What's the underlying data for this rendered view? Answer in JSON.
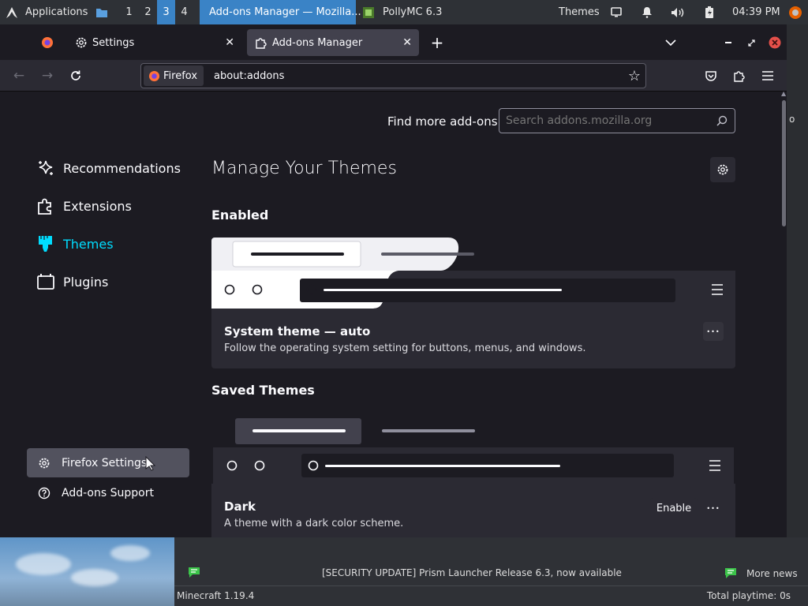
{
  "taskbar": {
    "apps_label": "Applications",
    "workspaces": [
      "1",
      "2",
      "3",
      "4"
    ],
    "active_workspace": "3",
    "tasks": [
      {
        "title": "Add-ons Manager — Mozilla...",
        "active": true
      },
      {
        "title": "PollyMC 6.3",
        "active": false
      }
    ],
    "themes_label": "Themes",
    "clock": "04:39 PM"
  },
  "browser": {
    "tabs": [
      {
        "label": "Settings",
        "selected": false
      },
      {
        "label": "Add-ons Manager",
        "selected": true
      }
    ],
    "identity_label": "Firefox",
    "url": "about:addons"
  },
  "addons": {
    "find_more_label": "Find more add-ons",
    "search_placeholder": "Search addons.mozilla.org",
    "categories": [
      {
        "label": "Recommendations",
        "icon": "sparkle-icon",
        "selected": false
      },
      {
        "label": "Extensions",
        "icon": "puzzle-icon",
        "selected": false
      },
      {
        "label": "Themes",
        "icon": "paintbrush-icon",
        "selected": true
      },
      {
        "label": "Plugins",
        "icon": "plugin-icon",
        "selected": false
      }
    ],
    "footer": {
      "settings": "Firefox Settings",
      "support": "Add-ons Support"
    },
    "heading": "Manage Your Themes",
    "enabled_heading": "Enabled",
    "saved_heading": "Saved Themes",
    "enabled_theme": {
      "name": "System theme — auto",
      "description": "Follow the operating system setting for buttons, menus, and windows."
    },
    "saved_theme": {
      "name": "Dark",
      "description": "A theme with a dark color scheme.",
      "enable_label": "Enable"
    },
    "more_glyph": "•••"
  },
  "polly": {
    "news": "[SECURITY UPDATE] Prism Launcher Release 6.3, now available",
    "more_news": "More news",
    "version": "Minecraft 1.19.4",
    "playtime": "Total playtime: 0s"
  },
  "colors": {
    "accent": "#00ddff",
    "taskbar_active": "#3a83c6",
    "close_red": "#e5504a"
  }
}
